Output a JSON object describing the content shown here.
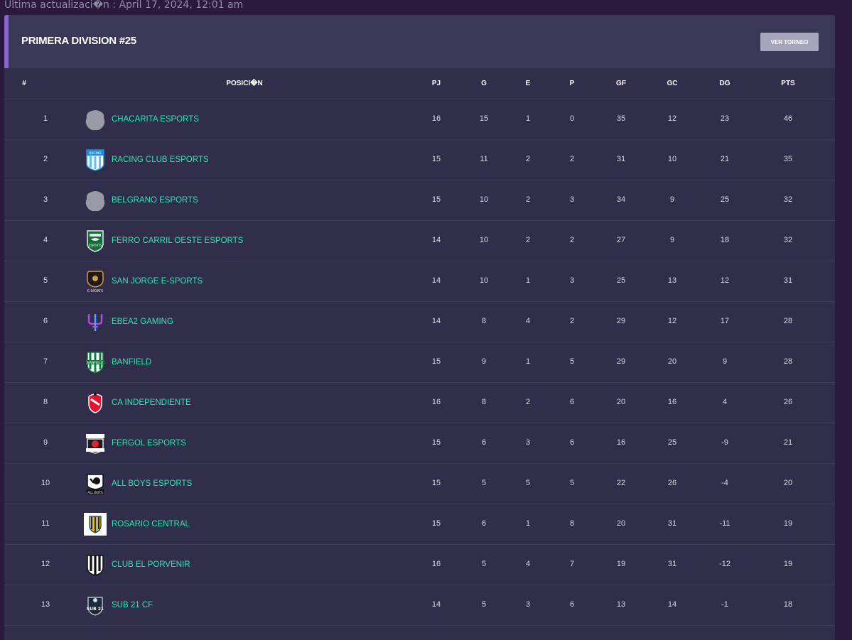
{
  "last_updated": "Ultima actualizaci�n : April 17, 2024, 12:01 am",
  "panel": {
    "title": "PRIMERA DIVISION #25",
    "button_label": "VER TORNEO"
  },
  "columns": [
    "#",
    "POSICI�N",
    "PJ",
    "G",
    "E",
    "P",
    "GF",
    "GC",
    "DG",
    "PTS"
  ],
  "rows": [
    {
      "pos": "1",
      "team": "CHACARITA ESPORTS",
      "logo": "placeholder-crest-icon",
      "pj": "16",
      "g": "15",
      "e": "1",
      "p": "0",
      "gf": "35",
      "gc": "12",
      "dg": "23",
      "pts": "46"
    },
    {
      "pos": "2",
      "team": "RACING CLUB ESPORTS",
      "logo": "racing-crest-icon",
      "logo_text": "RACING",
      "pj": "15",
      "g": "11",
      "e": "2",
      "p": "2",
      "gf": "31",
      "gc": "10",
      "dg": "21",
      "pts": "35"
    },
    {
      "pos": "3",
      "team": "BELGRANO ESPORTS",
      "logo": "placeholder-crest-icon",
      "pj": "15",
      "g": "10",
      "e": "2",
      "p": "3",
      "gf": "34",
      "gc": "9",
      "dg": "25",
      "pts": "32"
    },
    {
      "pos": "4",
      "team": "FERRO CARRIL OESTE ESPORTS",
      "logo": "ferro-crest-icon",
      "logo_text": "ESPORTS",
      "pj": "14",
      "g": "10",
      "e": "2",
      "p": "2",
      "gf": "27",
      "gc": "9",
      "dg": "18",
      "pts": "32"
    },
    {
      "pos": "5",
      "team": "SAN JORGE E-SPORTS",
      "logo": "san-jorge-crest-icon",
      "logo_text": "E-SPORTS",
      "pj": "14",
      "g": "10",
      "e": "1",
      "p": "3",
      "gf": "25",
      "gc": "13",
      "dg": "12",
      "pts": "31"
    },
    {
      "pos": "6",
      "team": "EBEA2 GAMING",
      "logo": "ebea2-trident-icon",
      "pj": "14",
      "g": "8",
      "e": "4",
      "p": "2",
      "gf": "29",
      "gc": "12",
      "dg": "17",
      "pts": "28"
    },
    {
      "pos": "7",
      "team": "BANFIELD",
      "logo": "banfield-crest-icon",
      "logo_text": "BANFIELD",
      "pj": "15",
      "g": "9",
      "e": "1",
      "p": "5",
      "gf": "29",
      "gc": "20",
      "dg": "9",
      "pts": "28"
    },
    {
      "pos": "8",
      "team": "CA INDEPENDIENTE",
      "logo": "independiente-crest-icon",
      "pj": "16",
      "g": "8",
      "e": "2",
      "p": "6",
      "gf": "20",
      "gc": "16",
      "dg": "4",
      "pts": "26"
    },
    {
      "pos": "9",
      "team": "FERGOL ESPORTS",
      "logo": "fergol-crest-icon",
      "pj": "15",
      "g": "6",
      "e": "3",
      "p": "6",
      "gf": "16",
      "gc": "25",
      "dg": "-9",
      "pts": "21"
    },
    {
      "pos": "10",
      "team": "ALL BOYS ESPORTS",
      "logo": "all-boys-crest-icon",
      "logo_text": "ALL BOYS",
      "pj": "15",
      "g": "5",
      "e": "5",
      "p": "5",
      "gf": "22",
      "gc": "26",
      "dg": "-4",
      "pts": "20"
    },
    {
      "pos": "11",
      "team": "ROSARIO CENTRAL",
      "logo": "rosario-central-crest-icon",
      "pj": "15",
      "g": "6",
      "e": "1",
      "p": "8",
      "gf": "20",
      "gc": "31",
      "dg": "-11",
      "pts": "19"
    },
    {
      "pos": "12",
      "team": "CLUB EL PORVENIR",
      "logo": "el-porvenir-crest-icon",
      "pj": "16",
      "g": "5",
      "e": "4",
      "p": "7",
      "gf": "19",
      "gc": "31",
      "dg": "-12",
      "pts": "19"
    },
    {
      "pos": "13",
      "team": "SUB 21 CF",
      "logo": "sub21-crest-icon",
      "logo_text": "SUB 21",
      "pj": "14",
      "g": "5",
      "e": "3",
      "p": "6",
      "gf": "13",
      "gc": "14",
      "dg": "-1",
      "pts": "18"
    }
  ],
  "colors": {
    "page_background": "#2b1a3e",
    "panel_background": "#302e4a",
    "header_background": "#3a3857",
    "accent": "#8a63d2",
    "team_link": "#2ee6b4",
    "button": "#a8a6bd"
  }
}
